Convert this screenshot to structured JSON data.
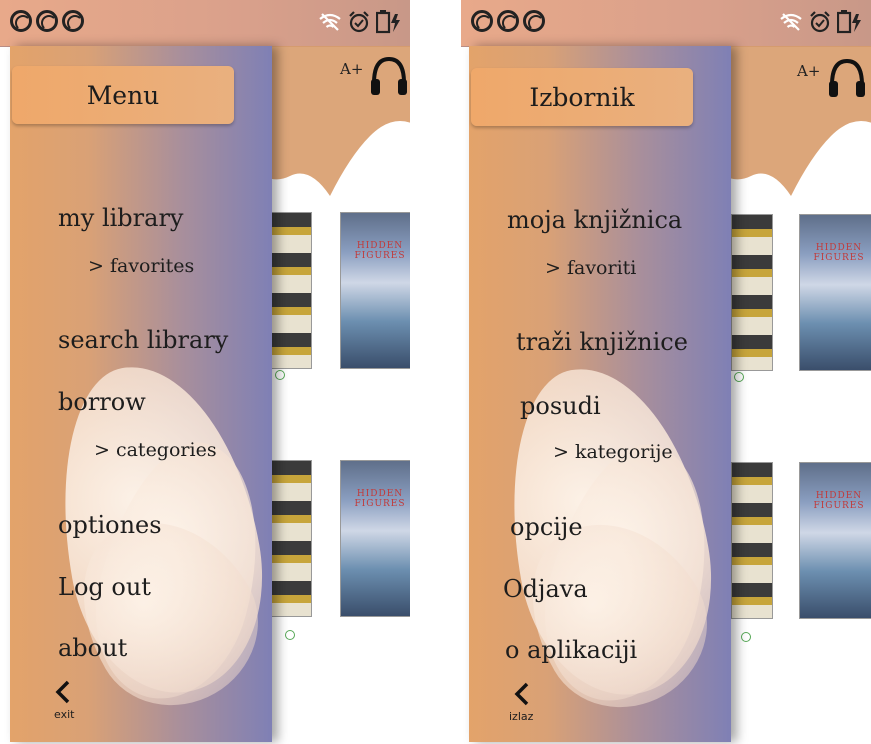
{
  "screens": [
    {
      "aplus": "A+",
      "menu_title": "Menu",
      "items": [
        "my library",
        "search library",
        "borrow",
        "optiones",
        "Log out",
        "about"
      ],
      "subitems": [
        "> favorites",
        "> categories"
      ],
      "back_label": "exit"
    },
    {
      "aplus": "A+",
      "menu_title": "Izbornik",
      "items": [
        "moja knjižnica",
        "traži knjižnice",
        "posudi",
        "opcije",
        "Odjava",
        "o aplikaciji"
      ],
      "subitems": [
        "> favoriti",
        "> kategorije"
      ],
      "back_label": "izlaz"
    }
  ],
  "colors": {
    "status_bar": "#e8a98a",
    "drawer_left": "#e3a36a",
    "drawer_right": "#7f80b5",
    "title_pill": "#efa86a"
  },
  "icons": [
    "wifi-off-icon",
    "alarm-clock-icon",
    "battery-charging-icon",
    "headphones-icon",
    "chevron-left-icon"
  ]
}
